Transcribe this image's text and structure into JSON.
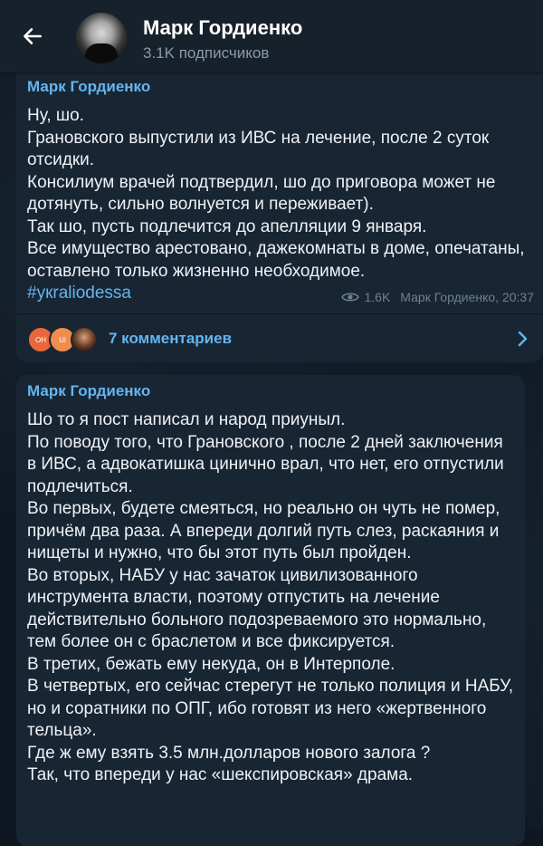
{
  "header": {
    "title": "Марк Гордиенко",
    "subscribers": "3.1K подписчиков"
  },
  "post1": {
    "author": "Марк Гордиенко",
    "text": "Ну, шо.\nГрановского выпустили из ИВС на лечение, после 2 суток отсидки.\nКонсилиум врачей подтвердил, шо до приговора может не дотянуть, сильно волнуется и переживает).\nТак шо, пусть подлечится до апелляции 9 января.\nВсе имущество арестовано, дажекомнаты в доме, опечатаны, оставлено только жизненно необходимое.",
    "hashtag": "#укraliodessa",
    "views": "1.6K",
    "signature": "Марк Гордиенко, 20:37",
    "comments": "7 комментариев",
    "commenter_initials": [
      "OH",
      "Ui"
    ]
  },
  "post2": {
    "author": "Марк Гордиенко",
    "text": "Шо то я пост написал и народ приуныл.\nПо поводу того, что Грановского , после 2 дней заключения в ИВС, а адвокатишка цинично врал, что нет, его отпустили подлечиться.\nВо первых, будете смеяться, но реально он чуть не помер, причём два раза. А впереди долгий путь слез, раскаяния и нищеты и нужно, что бы этот путь был пройден.\nВо вторых, НАБУ у нас зачаток цивилизованного инструмента власти, поэтому отпустить на лечение действительно больного подозреваемого это нормально, тем более он с браслетом и все фиксируется.\nВ третих, бежать ему некуда, он в Интерполе.\nВ четвертых, его сейчас стерегут не только полиция и НАБУ, но и соратники по ОПГ, ибо готовят из него «жертвенного тельца».\nГде ж ему взять 3.5 млн.долларов нового залога ?\nТак, что впереди у нас «шекспировская» драма."
  },
  "colors": {
    "header_bg": "#17212b",
    "bubble_bg": "#182533",
    "accent": "#64b5ef",
    "app_bg": "#0e1621"
  },
  "icons": [
    "back-arrow-icon",
    "eye-icon",
    "chevron-right-icon"
  ]
}
